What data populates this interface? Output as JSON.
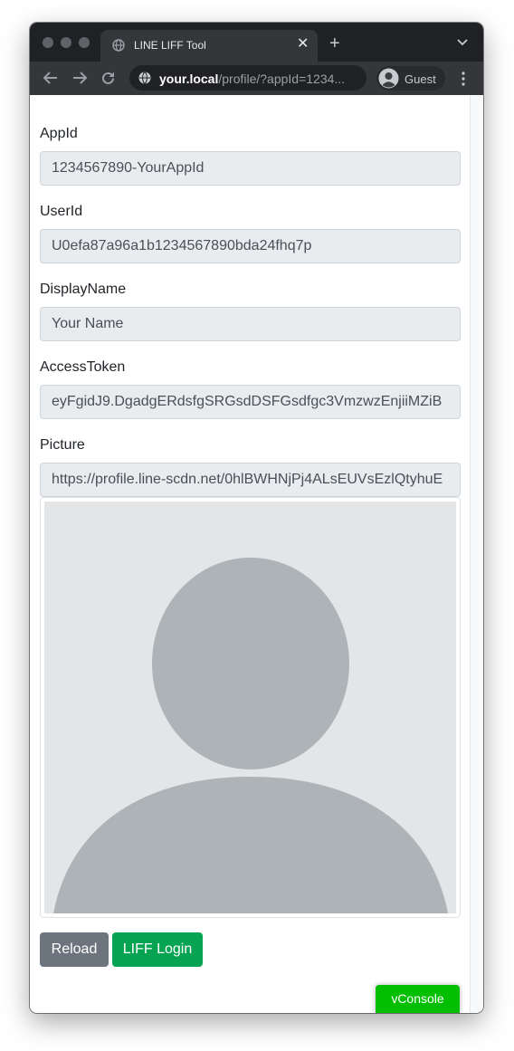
{
  "browser": {
    "tab_title": "LINE LIFF Tool",
    "tab_close_glyph": "✕",
    "new_tab_glyph": "+",
    "url_host": "your.local",
    "url_rest": "/profile/?appId=1234...",
    "profile_label": "Guest",
    "icons": [
      "globe-icon",
      "back-icon",
      "forward-icon",
      "reload-icon",
      "site-info-icon",
      "guest-avatar-icon",
      "kebab-menu-icon",
      "tab-list-icon"
    ]
  },
  "form": {
    "appid": {
      "label": "AppId",
      "value": "1234567890-YourAppId"
    },
    "userid": {
      "label": "UserId",
      "value": "U0efa87a96a1b1234567890bda24fhq7p"
    },
    "displayname": {
      "label": "DisplayName",
      "value": "Your Name"
    },
    "accesstoken": {
      "label": "AccessToken",
      "value": "eyFgidJ9.DgadgERdsfgSRGsdDSFGsdfgc3VmzwzEnjiiMZiB"
    },
    "picture": {
      "label": "Picture",
      "value": "https://profile.line-scdn.net/0hlBWHNjPj4ALsEUVsEzlQtyhuE"
    }
  },
  "buttons": {
    "reload": "Reload",
    "liff_login": "LIFF Login",
    "vconsole": "vConsole"
  },
  "colors": {
    "reload_button": "#6c757d",
    "login_button": "#06a452",
    "vconsole_button": "#04be02",
    "placeholder_bg": "#e3e5e7",
    "placeholder_figure": "#aeb3b7"
  }
}
